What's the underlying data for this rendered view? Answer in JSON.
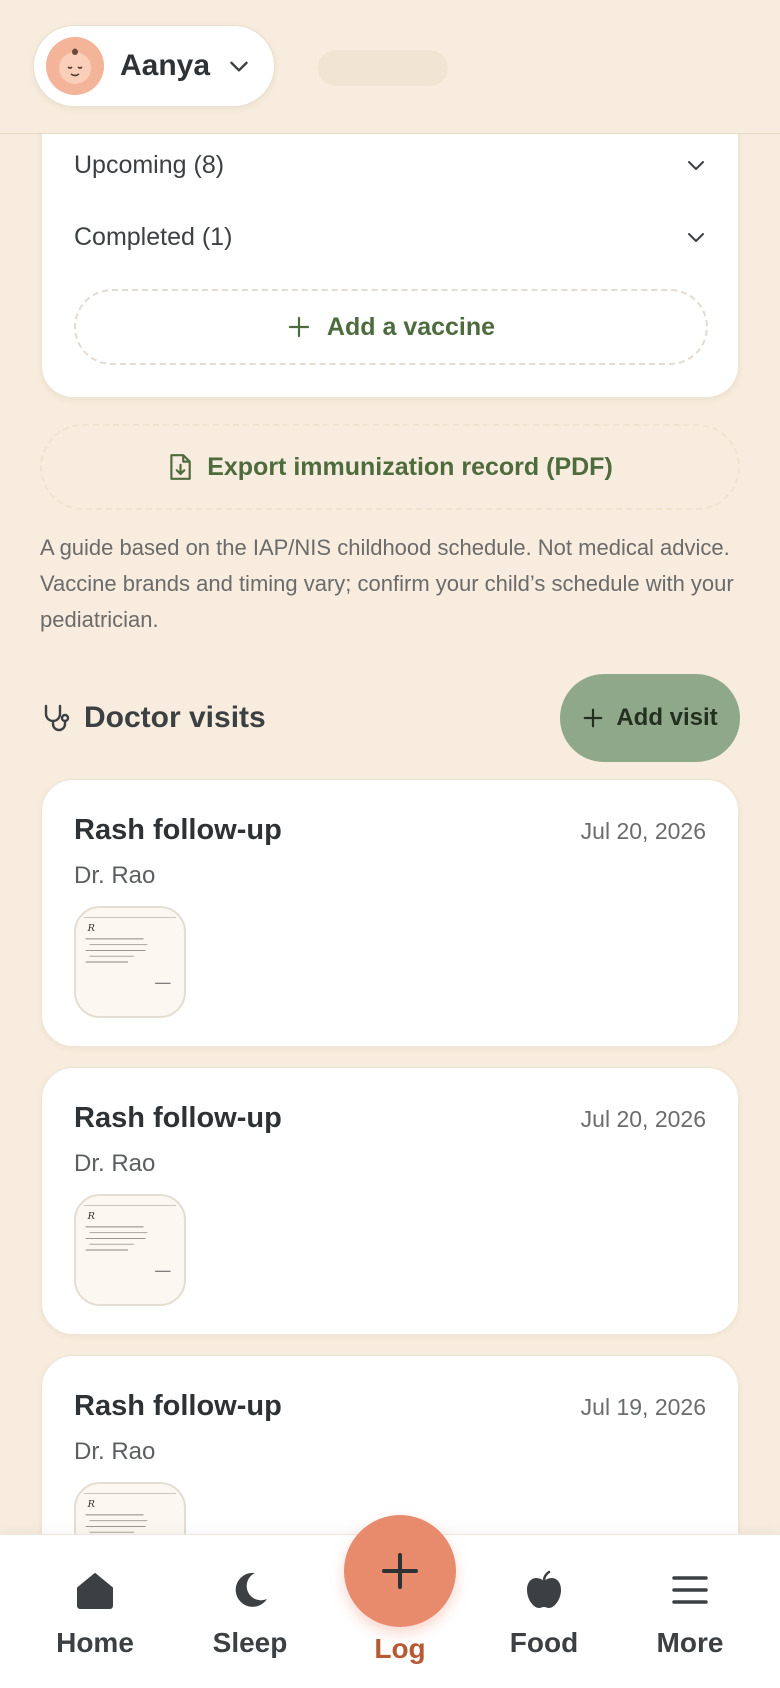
{
  "header": {
    "child_name": "Aanya"
  },
  "vaccines": {
    "upcoming_label": "Upcoming (8)",
    "completed_label": "Completed (1)",
    "add_vaccine_label": "Add a vaccine",
    "export_label": "Export immunization record (PDF)",
    "disclaimer": "A guide based on the IAP/NIS childhood schedule. Not medical advice. Vaccine brands and timing vary; confirm your child’s schedule with your pediatrician."
  },
  "doctor_visits": {
    "title": "Doctor visits",
    "add_visit_label": "Add visit",
    "visits": [
      {
        "title": "Rash follow-up",
        "doctor": "Dr. Rao",
        "date": "Jul 20, 2026"
      },
      {
        "title": "Rash follow-up",
        "doctor": "Dr. Rao",
        "date": "Jul 20, 2026"
      },
      {
        "title": "Rash follow-up",
        "doctor": "Dr. Rao",
        "date": "Jul 19, 2026"
      }
    ]
  },
  "nav": {
    "home": "Home",
    "sleep": "Sleep",
    "log": "Log",
    "food": "Food",
    "more": "More"
  },
  "icons": {
    "chevron": "chevron-down-icon",
    "plus": "plus-icon",
    "export": "file-download-icon",
    "stethoscope": "stethoscope-icon",
    "home": "home-icon",
    "sleep": "moon-icon",
    "food": "apple-icon",
    "more": "menu-icon"
  },
  "colors": {
    "background": "#f7ecdd",
    "accent_green": "#4d6b3d",
    "add_visit_bg": "#8fa88a",
    "fab": "#e88a6c",
    "fab_label": "#b65a35"
  }
}
